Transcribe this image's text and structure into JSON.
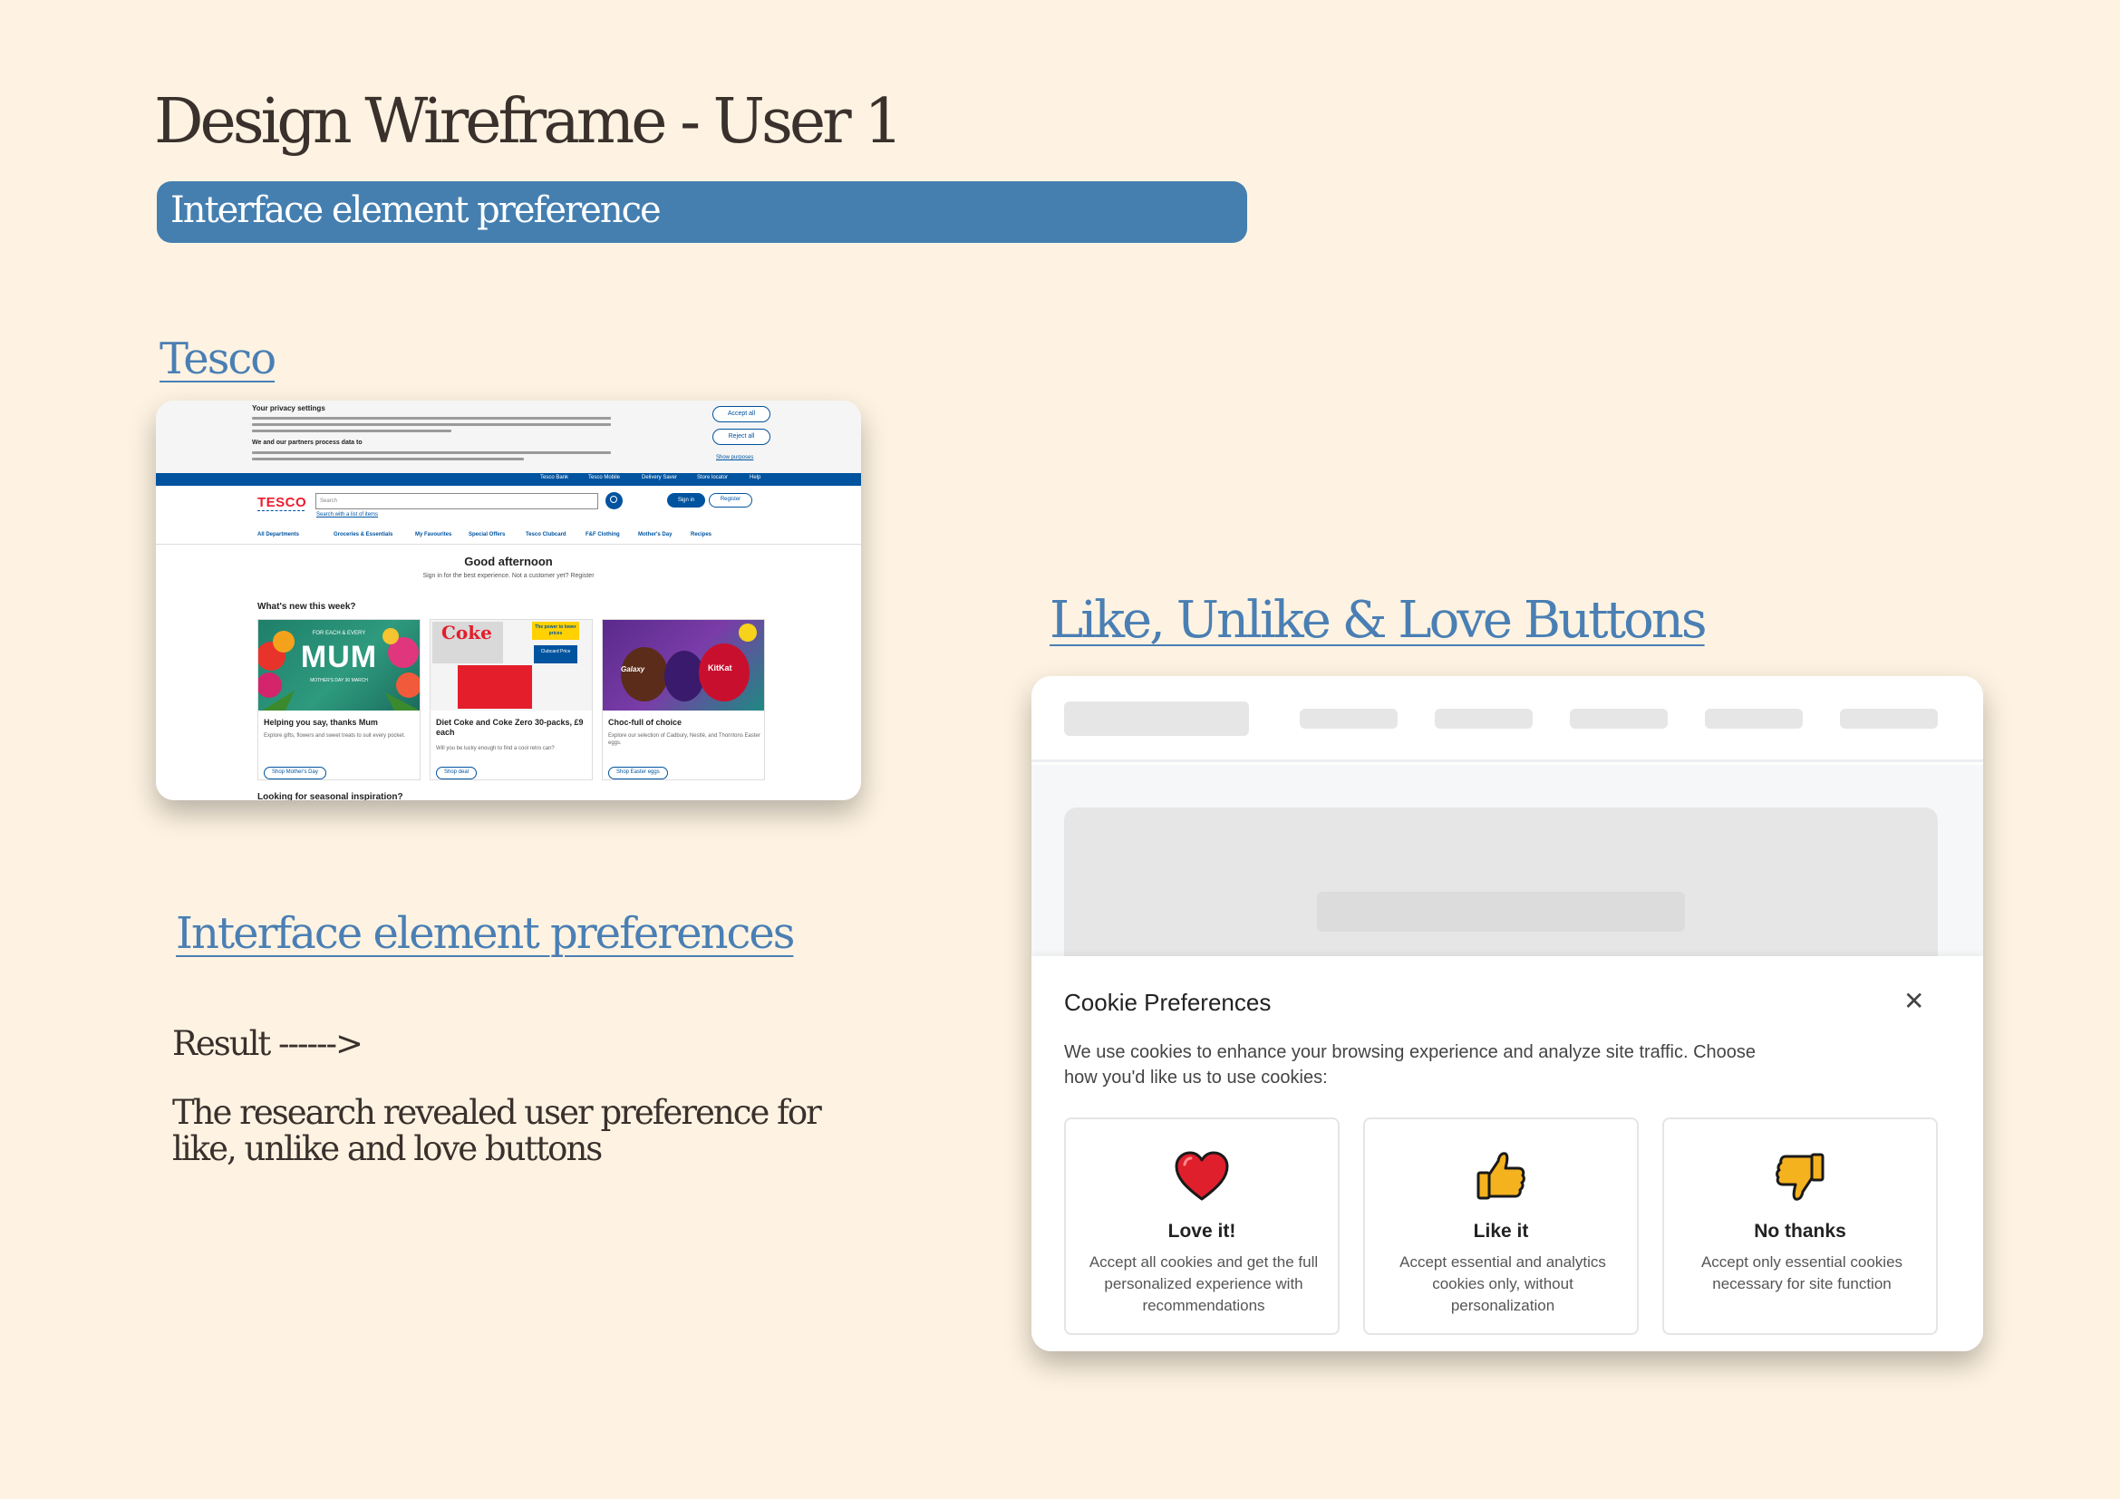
{
  "title": "Design Wireframe - User 1",
  "banner": "Interface element preference",
  "section_tesco": "Tesco",
  "section_preferences": "Interface element preferences",
  "section_buttons": "Like, Unlike & Love Buttons",
  "result_label": "Result ------>",
  "finding": "The research revealed user preference for like, unlike and love buttons",
  "tesco": {
    "privacy_title": "Your privacy settings",
    "privacy_sub": "We and our partners process data to",
    "accept_all": "Accept all",
    "reject_all": "Reject all",
    "show_purposes": "Show purposes",
    "util_links": [
      "Tesco Bank",
      "Tesco Mobile",
      "Delivery Saver",
      "Store locator",
      "Help"
    ],
    "logo": "TESCO",
    "search_placeholder": "Search",
    "search_list_link": "Search with a list of items",
    "sign_in": "Sign in",
    "register": "Register",
    "nav": [
      "All Departments",
      "Groceries & Essentials",
      "My Favourites",
      "Special Offers",
      "Tesco Clubcard",
      "F&F Clothing",
      "Mother's Day",
      "Recipes"
    ],
    "greeting": "Good afternoon",
    "greeting_sub": "Sign in for the best experience. Not a customer yet? Register",
    "whats_new": "What's new this week?",
    "cards": [
      {
        "title": "Helping you say, thanks Mum",
        "desc": "Explore gifts, flowers and sweet treats to suit every pocket.",
        "button": "Shop Mother's Day",
        "img_line1": "FOR EACH & EVERY",
        "img_line2": "MUM",
        "img_line3": "MOTHER'S DAY 30 MARCH"
      },
      {
        "title": "Diet Coke and Coke Zero 30-packs, £9 each",
        "desc": "Will you be lucky enough to find a cool retro can?",
        "button": "Shop deal",
        "img_line1": "Coke",
        "img_line2": "The power to lower prices",
        "img_line3": "Clubcard Price"
      },
      {
        "title": "Choc-full of choice",
        "desc": "Explore our selection of Cadbury, Nestlé, and Thorntons Easter eggs.",
        "button": "Shop Easter eggs",
        "img_line1": "Galaxy",
        "img_line2": "KitKat",
        "img_line3": ""
      }
    ],
    "more_heading": "Looking for seasonal inspiration?"
  },
  "cookie": {
    "title": "Cookie Preferences",
    "description": "We use cookies to enhance your browsing experience and analyze site traffic. Choose how you'd like us to use cookies:",
    "close_glyph": "✕",
    "options": [
      {
        "icon": "heart-icon",
        "title": "Love it!",
        "desc": "Accept all cookies and get the full personalized experience with recommendations"
      },
      {
        "icon": "thumbs-up-icon",
        "title": "Like it",
        "desc": "Accept essential and analytics cookies only, without personalization"
      },
      {
        "icon": "thumbs-down-icon",
        "title": "No thanks",
        "desc": "Accept only essential cookies necessary for site function"
      }
    ]
  },
  "colors": {
    "background": "#fef3e2",
    "accent_blue": "#457fb0",
    "link_blue": "#4a7fb4",
    "tesco_blue": "#00539f",
    "tesco_red": "#ee1c2e"
  }
}
